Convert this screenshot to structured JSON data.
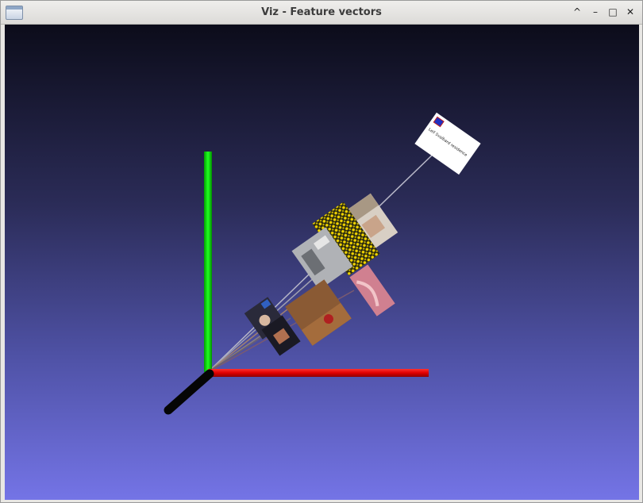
{
  "window": {
    "title": "Viz - Feature vectors",
    "controls": {
      "maximize_up": "^",
      "minimize": "–",
      "restore": "□",
      "close": "✕"
    }
  },
  "scene": {
    "background_top": "#0c0c1a",
    "background_bottom": "#7474e6",
    "axes": {
      "x_color": "#e00000",
      "y_color": "#00d000",
      "z_color": "#000000"
    },
    "card_label_text": "Leif Svalbard residence"
  }
}
